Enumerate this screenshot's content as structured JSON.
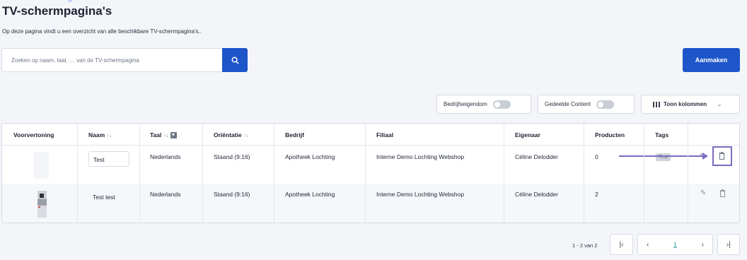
{
  "page": {
    "title": "TV-schermpagina's",
    "subtitle": "Op deze pagina vindt u een overzicht van alle beschikbare TV-schermpagina's.."
  },
  "search": {
    "placeholder": "Zoeken op naam, taal, … van de TV-schermpagina",
    "icon": "search-icon"
  },
  "actions": {
    "create_label": "Aanmaken"
  },
  "filters": {
    "company_property_label": "Bedrijfseigendom",
    "company_property_on": false,
    "shared_content_label": "Gedeelde Content",
    "shared_content_on": false,
    "columns_label": "Toon kolommen"
  },
  "table": {
    "headers": {
      "preview": "Voorvertoning",
      "name": "Naam",
      "language": "Taal",
      "orientation": "Oriëntatie",
      "company": "Bedrijf",
      "branch": "Filiaal",
      "owner": "Eigenaar",
      "products": "Producten",
      "tags": "Tags"
    },
    "sort_glyph": "↑↓",
    "rows": [
      {
        "name": "Test",
        "language": "Nederlands",
        "orientation": "Staand (9:16)",
        "company": "Apotheek Lochting",
        "branch": "Interne Demo Lochting Webshop",
        "owner": "Céline Delodder",
        "products": "0",
        "tag": "Test"
      },
      {
        "name": "Test test",
        "language": "Nederlands",
        "orientation": "Staand (9:16)",
        "company": "Apotheek Lochting",
        "branch": "Interne Demo Lochting Webshop",
        "owner": "Céline Delodder",
        "products": "2",
        "tag": ""
      }
    ]
  },
  "pagination": {
    "range_text": "1 - 2 van 2",
    "current_page": "1",
    "first_icon": "first-page-icon",
    "prev_icon": "chevron-left-icon",
    "next_icon": "chevron-right-icon",
    "last_icon": "last-page-icon"
  },
  "colors": {
    "primary": "#1e55c9",
    "annotation": "#7d6ac2",
    "background": "#f4f5f9"
  }
}
